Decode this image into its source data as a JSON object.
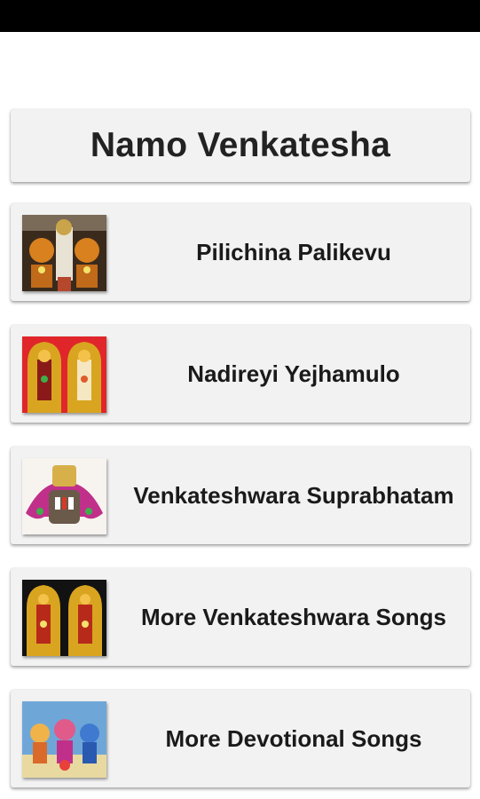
{
  "app": {
    "title": "Namo Venkatesha"
  },
  "menu": {
    "items": [
      {
        "label": "Pilichina Palikevu",
        "image": "deity-image"
      },
      {
        "label": "Nadireyi Yejhamulo",
        "image": "deity-image"
      },
      {
        "label": "Venkateshwara Suprabhatam",
        "image": "deity-image"
      },
      {
        "label": "More Venkateshwara Songs",
        "image": "deity-image"
      },
      {
        "label": "More Devotional Songs",
        "image": "deity-image"
      }
    ]
  },
  "colors": {
    "status_bar": "#000000",
    "card_background": "#f2f2f2",
    "text": "#222222"
  }
}
